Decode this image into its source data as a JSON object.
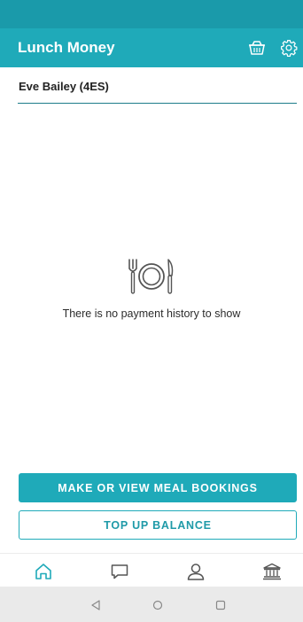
{
  "app": {
    "title": "Lunch Money"
  },
  "header_icons": [
    "basket-icon",
    "gear-icon"
  ],
  "student": {
    "name": "Eve Bailey (4ES)"
  },
  "empty_state": {
    "icon": "cutlery-plate-icon",
    "message": "There is no payment history to show"
  },
  "actions": {
    "meal_bookings_label": "MAKE OR VIEW MEAL BOOKINGS",
    "top_up_label": "TOP UP BALANCE"
  },
  "bottom_nav": [
    "home-icon",
    "chat-icon",
    "profile-icon",
    "bank-icon"
  ],
  "colors": {
    "accent": "#1faab9",
    "status_bar": "#1a9aaa",
    "divider": "#1d7c8a"
  }
}
